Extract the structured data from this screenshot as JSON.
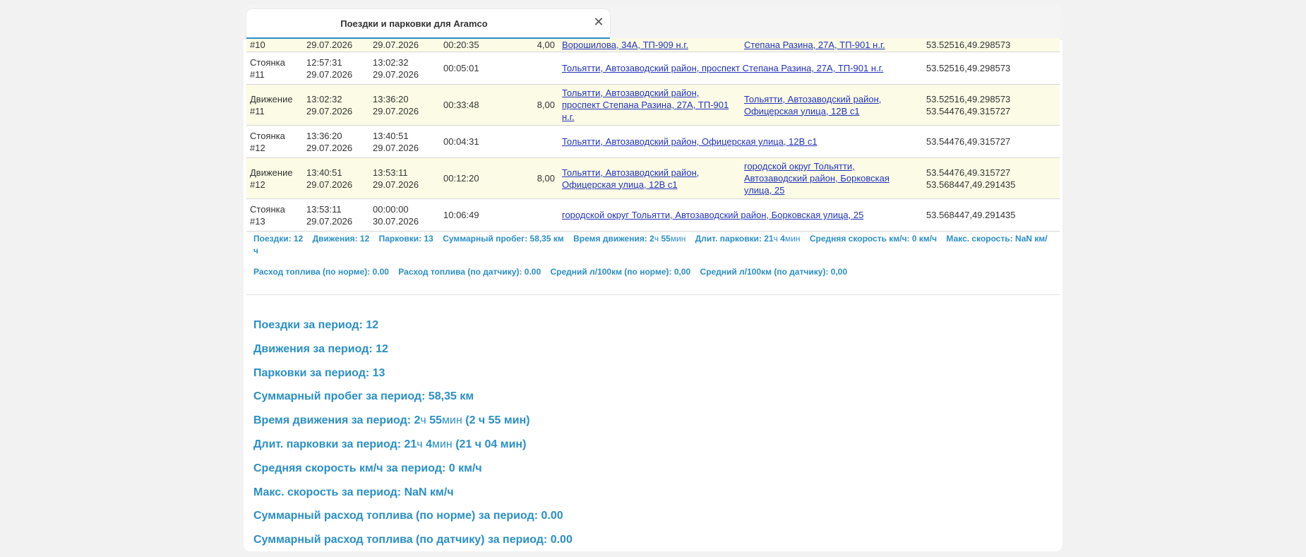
{
  "dialog": {
    "title": "Поездки и парковки для Aramco"
  },
  "rows": [
    {
      "kind": "move",
      "cut": true,
      "type_label": "#10",
      "start": "29.07.2026",
      "end": "29.07.2026",
      "duration": "00:20:35",
      "mileage": "4,00",
      "addr_from": "Ворошилова, 34А, ТП-909 н.г.",
      "addr_to": "Степана Разина, 27А, ТП-901 н.г.",
      "coords": "53.52516,49.298573"
    },
    {
      "kind": "park",
      "type1": "Стоянка",
      "type2": "#11",
      "time_start": "12:57:31",
      "date_start": "29.07.2026",
      "time_end": "13:02:32",
      "date_end": "29.07.2026",
      "duration": "00:05:01",
      "mileage": "",
      "address": "Тольятти, Автозаводский район, проспект Степана Разина, 27А, ТП-901 н.г.",
      "coords1": "53.52516,49.298573",
      "coords2": ""
    },
    {
      "kind": "move",
      "type1": "Движение",
      "type2": "#11",
      "time_start": "13:02:32",
      "date_start": "29.07.2026",
      "time_end": "13:36:20",
      "date_end": "29.07.2026",
      "duration": "00:33:48",
      "mileage": "8,00",
      "addr_from": "Тольятти, Автозаводский район, проспект Степана Разина, 27А, ТП-901 н.г.",
      "addr_to": "Тольятти, Автозаводский район, Офицерская улица, 12В с1",
      "coords1": "53.52516,49.298573",
      "coords2": "53.54476,49.315727"
    },
    {
      "kind": "park",
      "type1": "Стоянка",
      "type2": "#12",
      "time_start": "13:36:20",
      "date_start": "29.07.2026",
      "time_end": "13:40:51",
      "date_end": "29.07.2026",
      "duration": "00:04:31",
      "mileage": "",
      "address": "Тольятти, Автозаводский район, Офицерская улица, 12В с1",
      "coords1": "53.54476,49.315727",
      "coords2": ""
    },
    {
      "kind": "move",
      "type1": "Движение",
      "type2": "#12",
      "time_start": "13:40:51",
      "date_start": "29.07.2026",
      "time_end": "13:53:11",
      "date_end": "29.07.2026",
      "duration": "00:12:20",
      "mileage": "8,00",
      "addr_from": "Тольятти, Автозаводский район, Офицерская улица, 12В с1",
      "addr_to": "городской округ Тольятти, Автозаводский район, Борковская улица, 25",
      "coords1": "53.54476,49.315727",
      "coords2": "53.568447,49.291435"
    },
    {
      "kind": "park",
      "type1": "Стоянка",
      "type2": "#13",
      "time_start": "13:53:11",
      "date_start": "29.07.2026",
      "time_end": "00:00:00",
      "date_end": "30.07.2026",
      "duration": "10:06:49",
      "mileage": "",
      "address": "городской округ Тольятти, Автозаводский район, Борковская улица, 25",
      "coords1": "53.568447,49.291435",
      "coords2": ""
    }
  ],
  "stats": {
    "trips": "Поездки: 12",
    "movements": "Движения: 12",
    "parkings": "Парковки: 13",
    "mileage": "Суммарный пробег: 58,35 км",
    "move_time_label": "Время движения: 2",
    "move_time_u1": "ч",
    "move_time_v2": " 55",
    "move_time_u2": "мин",
    "park_time_label": "Длит. парковки: 21",
    "park_time_u1": "ч",
    "park_time_v2": " 4",
    "park_time_u2": "мин",
    "avg_speed": "Средняя скорость км/ч: 0 км/ч",
    "max_speed": "Макс. скорость: NaN км/ч",
    "fuel_norm": "Расход топлива (по норме): 0.00",
    "fuel_sensor": "Расход топлива (по датчику): 0.00",
    "avg_norm": "Средний л/100км (по норме): 0,00",
    "avg_sensor": "Средний л/100км (по датчику): 0,00"
  },
  "period": {
    "trips": "Поездки за период: 12",
    "movements": "Движения за период: 12",
    "parkings": "Парковки за период: 13",
    "mileage": "Суммарный пробег за период: 58,35 км",
    "move_time_a": "Время движения за период: 2",
    "move_time_u1": "ч",
    "move_time_b": " 55",
    "move_time_u2": "мин",
    "move_time_c": " (2 ч 55 мин)",
    "park_time_a": "Длит. парковки за период: 21",
    "park_time_u1": "ч",
    "park_time_b": " 4",
    "park_time_u2": "мин",
    "park_time_c": " (21 ч 04 мин)",
    "avg_speed": "Средняя скорость км/ч за период: 0 км/ч",
    "max_speed": "Макс. скорость за период: NaN км/ч",
    "fuel_norm": "Суммарный расход топлива (по норме) за период: 0.00",
    "fuel_sensor": "Суммарный расход топлива (по датчику) за период: 0.00"
  }
}
